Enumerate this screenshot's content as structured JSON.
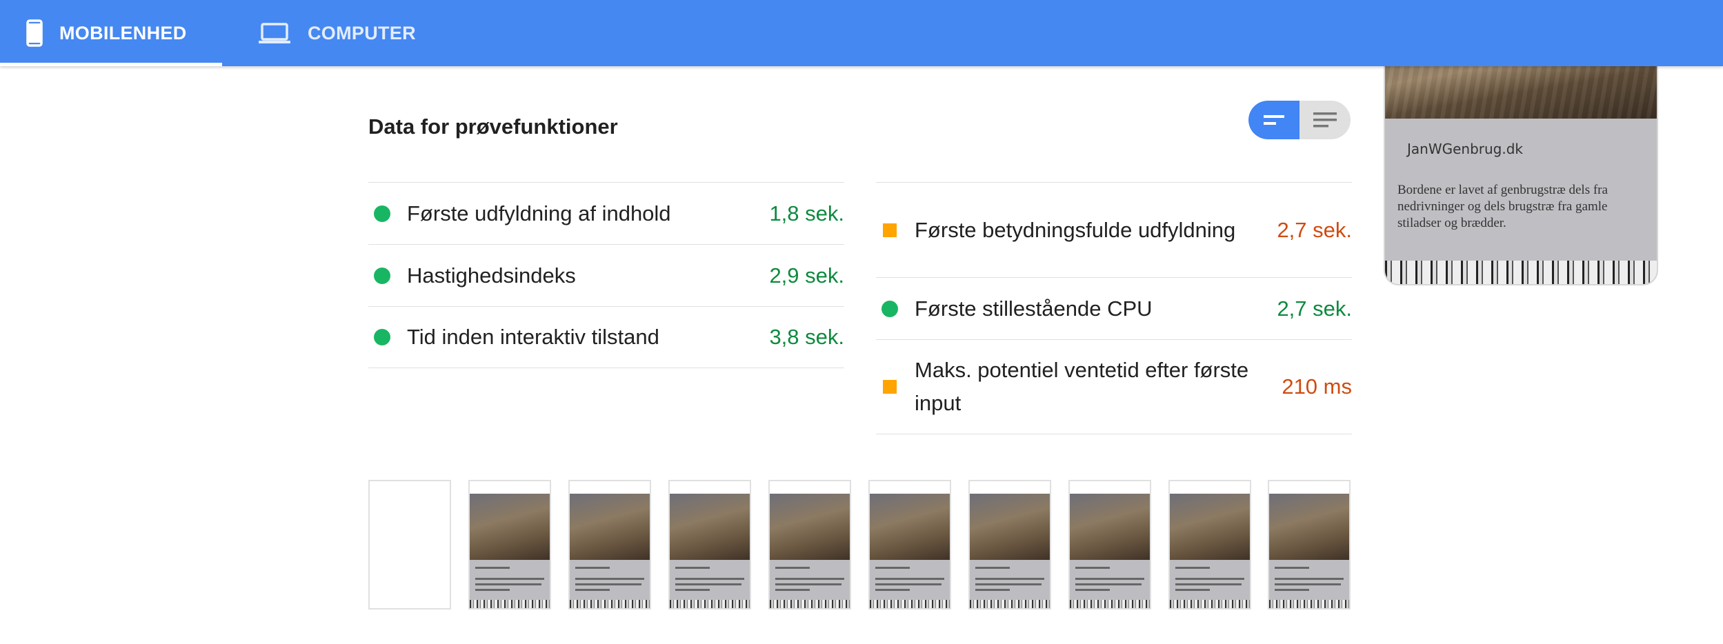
{
  "tabs": [
    {
      "label": "MOBILENHED",
      "icon": "phone-icon",
      "active": true
    },
    {
      "label": "COMPUTER",
      "icon": "laptop-icon",
      "active": false
    }
  ],
  "section": {
    "title": "Data for prøvefunktioner"
  },
  "metrics_left": [
    {
      "label": "Første udfyldning af indhold",
      "value": "1,8 sek.",
      "status": "pass"
    },
    {
      "label": "Hastighedsindeks",
      "value": "2,9 sek.",
      "status": "pass"
    },
    {
      "label": "Tid inden interaktiv tilstand",
      "value": "3,8 sek.",
      "status": "pass"
    }
  ],
  "metrics_right": [
    {
      "label": "Første betydningsfulde udfyldning",
      "value": "2,7 sek.",
      "status": "average"
    },
    {
      "label": "Første stillestående CPU",
      "value": "2,7 sek.",
      "status": "pass"
    },
    {
      "label": "Maks. potentiel ventetid efter første input",
      "value": "210 ms",
      "status": "average"
    }
  ],
  "screenshot": {
    "site_name": "JanWGenbrug.dk",
    "description": "Bordene er lavet af genbrugstræ dels fra nedrivninger og dels brugstræ fra gamle stiladser og brædder."
  },
  "filmstrip": {
    "frames": 10,
    "blank_frames": 1
  },
  "colors": {
    "header": "#4688f1",
    "pass": "#0d8a3e",
    "average": "#d04b0f",
    "pass_dot": "#18b663",
    "average_square": "#ffa400",
    "toggle_active": "#4285f4"
  }
}
